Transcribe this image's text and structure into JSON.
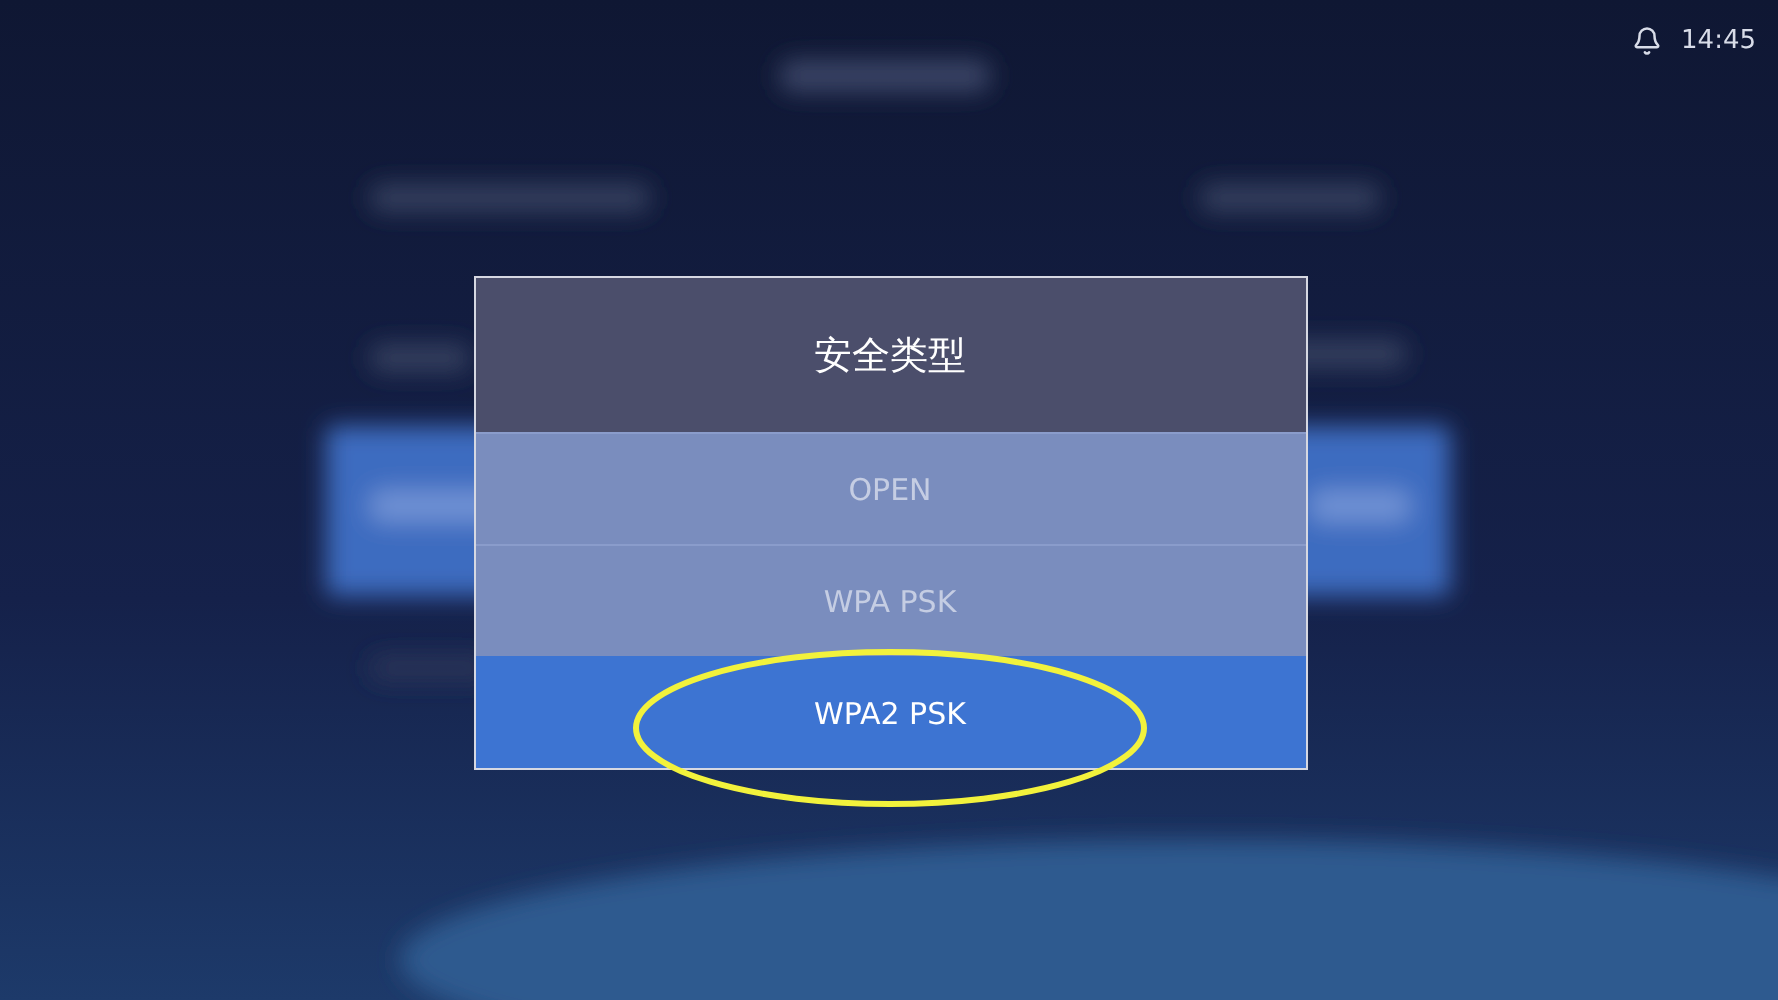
{
  "status_bar": {
    "time": "14:45"
  },
  "dialog": {
    "title": "安全类型",
    "options": [
      {
        "label": "OPEN",
        "selected": false
      },
      {
        "label": "WPA PSK",
        "selected": false
      },
      {
        "label": "WPA2 PSK",
        "selected": true
      }
    ]
  }
}
